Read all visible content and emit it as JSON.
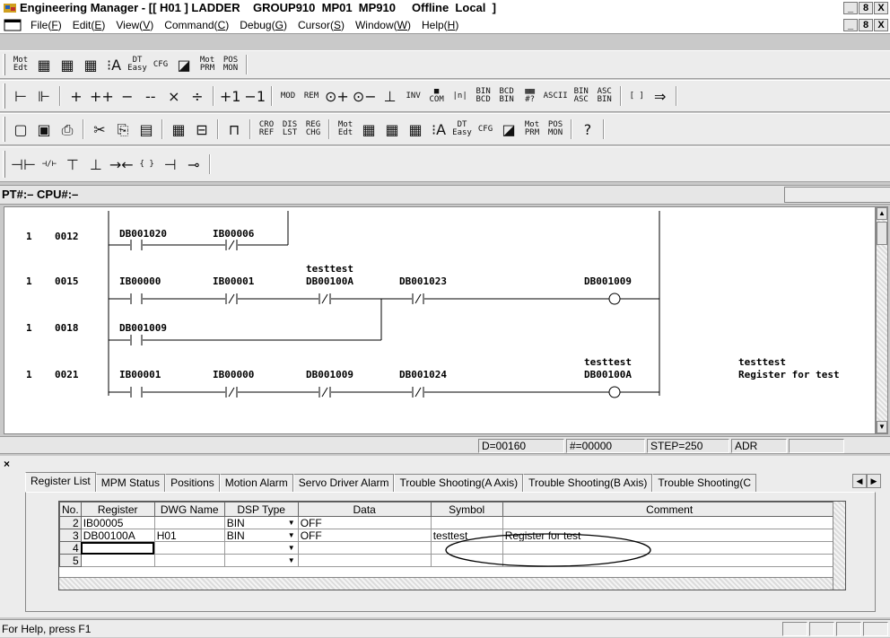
{
  "window": {
    "title": "Engineering Manager - [[ H01 ] LADDER    GROUP910  MP01  MP910     Offline  Local  ]",
    "buttons": [
      "_",
      "8",
      "X"
    ]
  },
  "menu": [
    {
      "label": "File(",
      "key": "F",
      "end": ")"
    },
    {
      "label": "Edit(",
      "key": "E",
      "end": ")"
    },
    {
      "label": "View(",
      "key": "V",
      "end": ")"
    },
    {
      "label": "Command(",
      "key": "C",
      "end": ")"
    },
    {
      "label": "Debug(",
      "key": "G",
      "end": ")"
    },
    {
      "label": "Cursor(",
      "key": "S",
      "end": ")"
    },
    {
      "label": "Window(",
      "key": "W",
      "end": ")"
    },
    {
      "label": "Help(",
      "key": "H",
      "end": ")"
    }
  ],
  "toolbar1": [
    "Mot\nEdt",
    "▦",
    "▦",
    "▦",
    "⁝A",
    "DT\nEasy",
    "CFG",
    "◪",
    "Mot\nPRM",
    "POS\nMON"
  ],
  "toolbar2": [
    "⊢",
    "⊩",
    "+",
    "++",
    "−",
    "--",
    "×",
    "÷",
    "+1",
    "−1",
    "MOD",
    "REM",
    "⊙+",
    "⊙−",
    "⊥",
    "INV",
    "■\nCOM",
    "|n|",
    "BIN\nBCD",
    "BCD\nBIN",
    "▦▦\n#?",
    "ASCII",
    "BIN\nASC",
    "ASC\nBIN",
    "[ ]",
    "⇒"
  ],
  "toolbar3": [
    "▢",
    "▣",
    "⎙",
    "✂",
    "⎘",
    "▤",
    "▦",
    "⊟",
    "⊓",
    "CRO\nREF",
    "DIS\nLST",
    "REG\nCHG",
    "Mot\nEdt",
    "▦",
    "▦",
    "▦",
    "⁝A",
    "DT\nEasy",
    "CFG",
    "◪",
    "Mot\nPRM",
    "POS\nMON",
    "?"
  ],
  "toolbar4": [
    "⊣⊢",
    "⊣/⊢",
    "⊤",
    "⊥",
    "→←",
    "{ }",
    "⊣",
    "⊸"
  ],
  "pt_bar": {
    "text": "PT#:– CPU#:–"
  },
  "ladder": {
    "rungs": [
      {
        "page": "1",
        "step": "0012"
      },
      {
        "page": "1",
        "step": "0015"
      },
      {
        "page": "1",
        "step": "0018"
      },
      {
        "page": "1",
        "step": "0021"
      }
    ],
    "contacts": {
      "r0c1": "DB001020",
      "r0c2": "IB00006",
      "r1c1": "IB00000",
      "r1c2": "IB00001",
      "r1c3_sym": "testtest",
      "r1c3": "DB00100A",
      "r1c4": "DB001023",
      "r1coil": "DB001009",
      "r2c1": "DB001009",
      "r3c1": "IB00001",
      "r3c2": "IB00000",
      "r3c3": "DB001009",
      "r3c4": "DB001024",
      "r3coil_sym": "testtest",
      "r3coil": "DB00100A",
      "r3comment_sym": "testtest",
      "r3comment": "Register for test"
    }
  },
  "status": {
    "d": "D=00160",
    "hash": "#=00000",
    "step": "STEP=250",
    "adr": "ADR"
  },
  "tabs": [
    "Register List",
    "MPM Status",
    "Positions",
    "Motion Alarm",
    "Servo Driver Alarm",
    "Trouble Shooting(A Axis)",
    "Trouble Shooting(B Axis)",
    "Trouble Shooting(C"
  ],
  "register_table": {
    "headers": [
      "No.",
      "Register",
      "DWG Name",
      "DSP Type",
      "Data",
      "Symbol",
      "Comment"
    ],
    "rows": [
      {
        "no": "2",
        "register": "IB00005",
        "dwg": "",
        "dsp": "BIN",
        "data": "OFF",
        "symbol": "",
        "comment": ""
      },
      {
        "no": "3",
        "register": "DB00100A",
        "dwg": "H01",
        "dsp": "BIN",
        "data": "OFF",
        "symbol": "testtest",
        "comment": "Register for test"
      },
      {
        "no": "4",
        "register": "",
        "dwg": "",
        "dsp": "",
        "data": "",
        "symbol": "",
        "comment": ""
      },
      {
        "no": "5",
        "register": "",
        "dwg": "",
        "dsp": "",
        "data": "",
        "symbol": "",
        "comment": ""
      }
    ]
  },
  "help_status": "For Help, press F1",
  "colors": {
    "highlight_ellipse": "#000000",
    "background": "#c9c9c9"
  }
}
